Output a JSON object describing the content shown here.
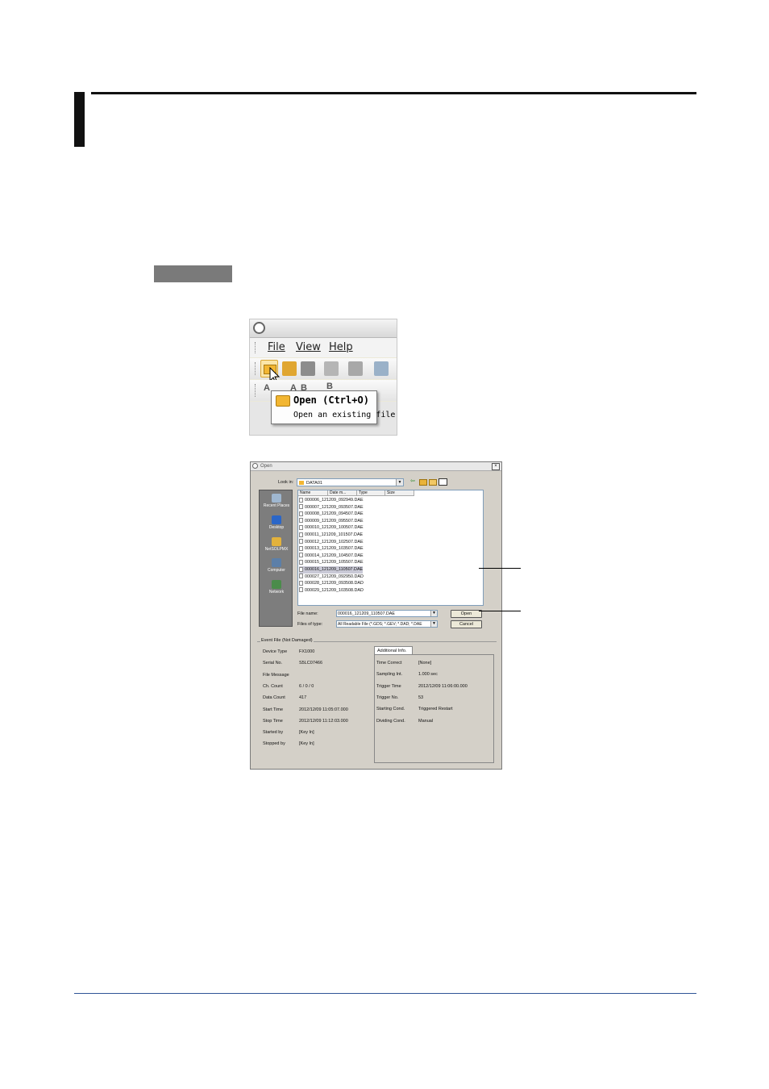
{
  "toolbar_screenshot": {
    "menu": [
      "File",
      "View",
      "Help"
    ],
    "tooltip_title": "Open (Ctrl+O)",
    "tooltip_description": "Open an existing file",
    "second_toolbar_labels": [
      "A",
      "A",
      "B",
      "B"
    ]
  },
  "open_dialog": {
    "title": "Open",
    "close_glyph": "×",
    "look_in_label": "Look in:",
    "look_in_value": "DATA01",
    "places": [
      "Recent Places",
      "Desktop",
      "NetSOLPMX",
      "Computer",
      "Network"
    ],
    "columns": [
      "Name",
      "Date m...",
      "Type",
      "Size"
    ],
    "files": [
      "000006_121209_092949.DAE",
      "000007_121209_093507.DAE",
      "000008_121209_094507.DAE",
      "000009_121209_095507.DAE",
      "000010_121209_100507.DAE",
      "000011_121209_101507.DAE",
      "000012_121209_102507.DAE",
      "000013_121209_103507.DAE",
      "000014_121209_104507.DAE",
      "000015_121209_105507.DAE",
      "000016_121209_110507.DAE",
      "000027_121209_092950.DAD",
      "000028_121209_093508.DAD",
      "000029_121209_103508.DAD"
    ],
    "selected_file_index": 10,
    "file_name_label": "File name:",
    "file_name_value": "000016_121209_110507.DAE",
    "files_of_type_label": "Files of type:",
    "files_of_type_value": "All Readable File (*.GDS; *.GEV; *.DAD; *.DAE",
    "open_button": "Open",
    "cancel_button": "Cancel",
    "event_file_group": "Event File (Not Damaged)",
    "info": [
      {
        "label": "Device Type",
        "value": "FX1000"
      },
      {
        "label": "Serial No.",
        "value": "S5LC07466"
      },
      {
        "label": "File Message",
        "value": ""
      },
      {
        "label": "Ch. Count",
        "value": "6 / 0 / 0"
      },
      {
        "label": "Data Count",
        "value": "417"
      },
      {
        "label": "Start Time",
        "value": "2012/12/09 11:05:07.000"
      },
      {
        "label": "Stop Time",
        "value": "2012/12/09 11:12:03.000"
      },
      {
        "label": "Started by",
        "value": "[Key In]"
      },
      {
        "label": "Stopped by",
        "value": "[Key In]"
      }
    ],
    "additional_tab": "Additional Info.",
    "additional": [
      {
        "label": "Time Correct",
        "value": "[None]"
      },
      {
        "label": "Sampling Int.",
        "value": "1.000 sec"
      },
      {
        "label": "Trigger Time",
        "value": "2012/12/09 11:06:00.000"
      },
      {
        "label": "Trigger No.",
        "value": "53"
      },
      {
        "label": "Starting Cond.",
        "value": "Triggered Restart"
      },
      {
        "label": "Dividing Cond.",
        "value": "Manual"
      }
    ]
  }
}
